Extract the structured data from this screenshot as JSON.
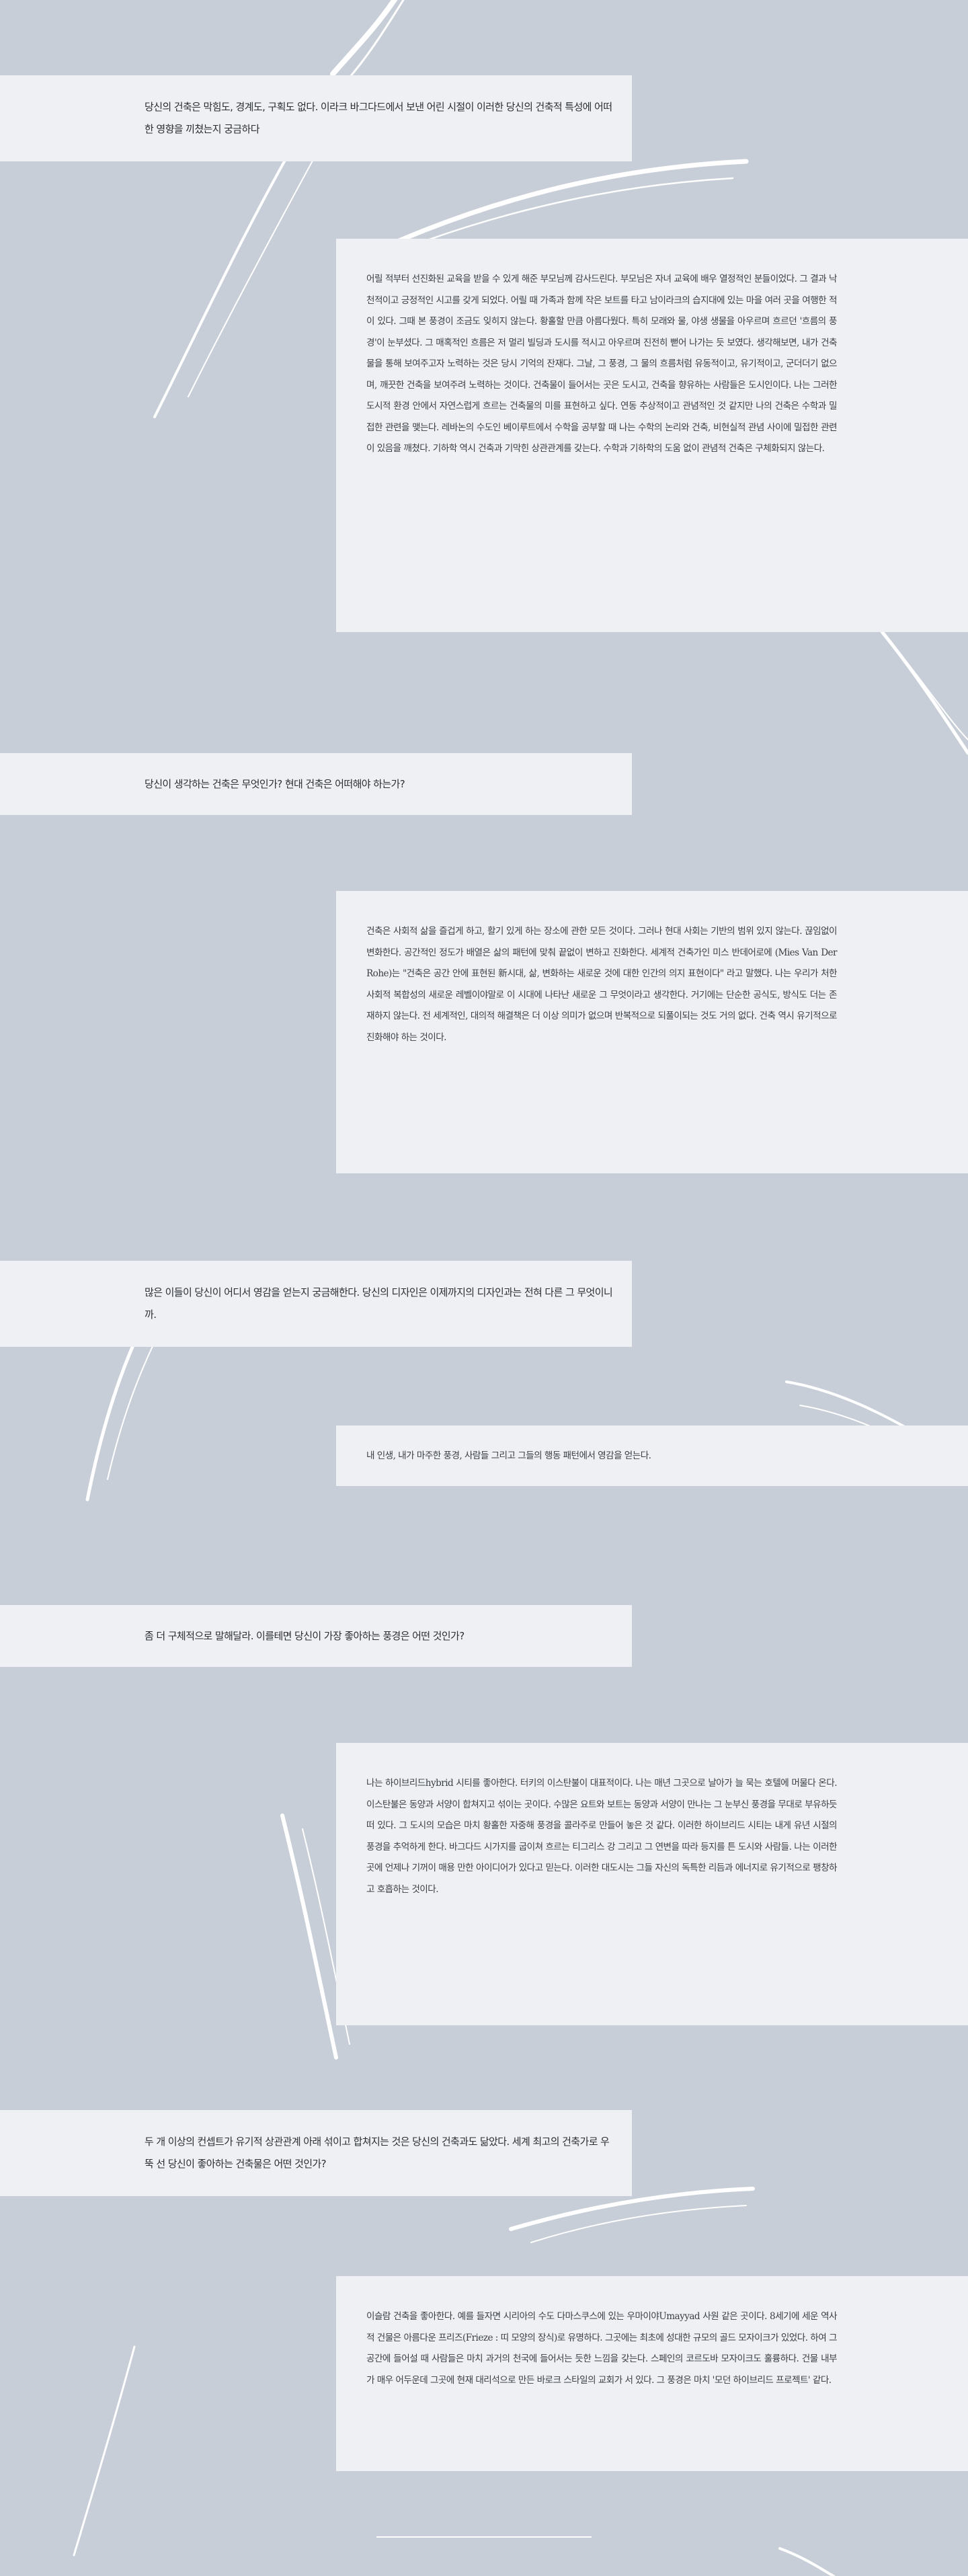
{
  "interview": [
    {
      "question": "당신의 건축은 막힘도, 경계도, 구획도 없다. 이라크 바그다드에서 보낸 어린 시절이 이러한 당신의 건축적 특성에 어떠한 영향을 끼쳤는지 궁금하다",
      "answer": "어릴 적부터 선진화된 교육을 받을 수 있게 해준 부모님께 감사드린다. 부모님은 자녀 교육에 배우 열정적인 분들이었다. 그 결과 낙천적이고 긍정적인 시고를 갖게 되었다. 어릴 때 가족과 함께 작은 보트를 타고 남이라크의 습지대에 있는 마을 여러 곳을 여행한 적이 있다. 그때 본 풍경이 조금도 잊히지 않는다. 황홀할 만큼 아름다웠다. 특히 모래와 물, 야생 생물을 아우르며 흐르던 '흐름의 풍경'이 눈부셨다. 그 매혹적인 흐름은 저 멀리 빌딩과 도시를 적시고 아우르며 진전히 뻗어 나가는 듯 보였다. 생각해보면, 내가 건축물을 통해 보여주고자 노력하는 것은 당시 기억의 잔재다. 그날, 그 풍경, 그 물의 흐름처럼 유동적이고, 유기적이고, 군더더기 없으며, 깨끗한 건축을 보여주려 노력하는 것이다. 건축물이 들어서는 곳은 도시고, 건축을 향유하는 사람들은 도시인이다. 나는 그러한 도시적 환경 안에서 자연스럽게 흐르는 건축물의 미를 표현하고 싶다. 연동 추상적이고 관념적인 것 같지만 나의 건축은 수학과 밀접한 관련을 맺는다. 레바논의 수도인 베이루트에서 수학을 공부할 때 나는 수학의 논리와 건축, 비현실적 관념 사이에 밀접한 관련이 있음을 깨쳤다. 기하학 역시 건축과 기막힌 상관관계를 갖는다. 수학과 기하학의 도움 없이 관념적 건축은 구체화되지 않는다."
    },
    {
      "question": "당신이 생각하는 건축은 무엇인가? 현대 건축은 어떠해야 하는가?",
      "answer": "건축은 사회적 삶을 즐겁게 하고, 활기 있게 하는 장소에 관한 모든 것이다. 그러나 현대 사회는 기반의 범위 있지 않는다. 끊임없이 변화한다. 공간적인 정도가 배열은 삶의 패턴에 맞춰 끝없이 변하고 진화한다. 세계적 건축가인 미스 반데어로에 (Mies Van Der Rohe)는 \"건축은 공간 안에 표현된 新시대, 삶, 변화하는 새로운 것에 대한 인간의 의지 표현이다\" 라고 말했다. 나는 우리가 처한 사회적 복합성의 새로운 레벨이야말로 이 시대에 나타난 새로운 그 무엇이라고 생각한다. 거기에는 단순한 공식도, 방식도 더는 존재하지 않는다. 전 세계적인, 대의적 해결책은 더 이상 의미가 없으며 반복적으로 되풀이되는 것도 거의 없다. 건축 역시 유기적으로 진화해야 하는 것이다."
    },
    {
      "question": "많은 이들이 당신이 어디서 영감을 얻는지 궁금해한다. 당신의 디자인은 이제까지의 디자인과는 전혀 다른 그 무엇이니까.",
      "answer": "내 인생, 내가 마주한 풍경, 사람들 그리고 그들의 행동 패턴에서 영감을 얻는다."
    },
    {
      "question": "좀 더 구체적으로 말해달라. 이를테면 당신이 가장 좋아하는 풍경은 어떤 것인가?",
      "answer": "나는 하이브리드hybrid 시티를 좋아한다. 터키의 이스탄불이 대표적이다. 나는 매년 그곳으로 날아가 늘 묵는 호텔에 머물다 온다. 이스탄불은 동양과 서양이 합쳐지고 섞이는 곳이다. 수많은 요트와 보트는 동양과 서양이 만나는 그 눈부신 풍경을 무대로 부유하듯 떠 있다. 그 도시의 모습은 마치 황홀한 자중해 풍경을 콜라주로 만들어 놓은 것 같다. 이러한 하이브리드 시티는 내게 유년 시절의 풍경을 추억하게 한다. 바그다드 시가지를 굽이쳐 흐르는 티그리스 강 그리고 그 연변을 따라 등지를 튼 도시와 사람들. 나는 이러한 곳에 언제나 기꺼이 매용 만한 아이디어가 있다고 믿는다. 이러한 대도시는 그들 자신의 독특한 리듬과 에너지로 유기적으로 팽창하고 호흡하는 것이다."
    },
    {
      "question": "두 개 이상의 컨셉트가 유기적 상관관계 아래 섞이고 합쳐지는 것은 당신의 건축과도 닮았다. 세계 최고의 건축가로 우뚝 선 당신이 좋아하는 건축물은 어떤 것인가?",
      "answer": "이슬람 건축을 좋아한다. 예를 들자면 시리아의 수도 다마스쿠스에 있는 우마이야Umayyad 사원 같은 곳이다. 8세기에 세운 역사적 건물은 아름다운 프리즈(Frieze : 띠 모양의 장식)로 유명하다. 그곳에는 최초에 성대한 규모의 골드 모자이크가 있었다. 하여 그 공간에 들어설 때 사람들은 마치 과거의 천국에 들어서는 듯한 느낌을 갖는다. 스페인의 코르도바 모자이크도 훌륭하다. 건물 내부가 매우 어두운데 그곳에 현재 대리석으로 만든 바로크 스타일의 교회가 서 있다. 그 풍경은 마치 '모던 하이브리드 프로젝트' 같다."
    }
  ]
}
